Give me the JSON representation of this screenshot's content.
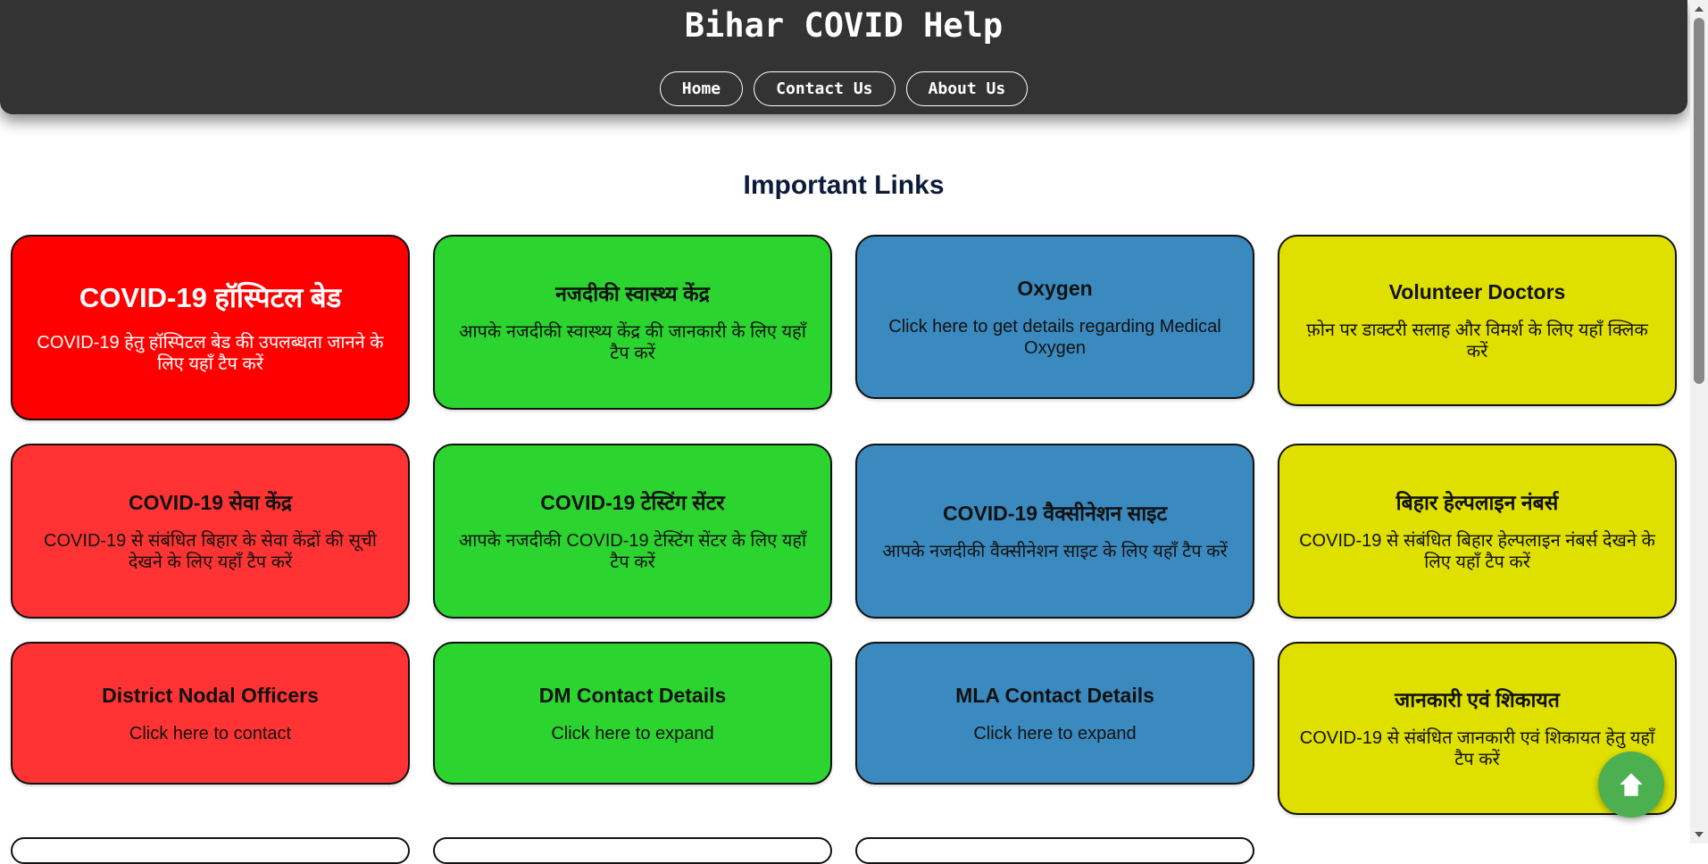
{
  "header": {
    "title": "Bihar COVID Help",
    "nav": [
      {
        "label": "Home"
      },
      {
        "label": "Contact Us"
      },
      {
        "label": "About Us"
      }
    ]
  },
  "main": {
    "section_title": "Important Links",
    "cards": [
      {
        "title": "COVID-19 हॉस्पिटल बेड",
        "description": "COVID-19 हेतु हॉस्पिटल बेड की उपलब्धता जानने के लिए यहाँ टैप करें",
        "color": "#ff0000"
      },
      {
        "title": "नजदीकी स्वास्थ्य केंद्र",
        "description": "आपके नजदीकी स्वास्थ्य केंद्र की जानकारी के लिए यहाँ टैप करें",
        "color": "#2bd42f"
      },
      {
        "title": "Oxygen",
        "description": "Click here to get details regarding Medical Oxygen",
        "color": "#3a8ac0"
      },
      {
        "title": "Volunteer Doctors",
        "description": "फ़ोन पर डाक्टरी सलाह और विमर्श के लिए यहाँ क्लिक करें",
        "color": "#e0e000"
      },
      {
        "title": "COVID-19 सेवा केंद्र",
        "description": "COVID-19 से संबंधित बिहार के सेवा केंद्रों की सूची देखने के लिए यहाँ टैप करें",
        "color": "#ff3333"
      },
      {
        "title": "COVID-19 टेस्टिंग सेंटर",
        "description": "आपके नजदीकी COVID-19 टेस्टिंग सेंटर के लिए यहाँ टैप करें",
        "color": "#2bd42f"
      },
      {
        "title": "COVID-19 वैक्सीनेशन साइट",
        "description": "आपके नजदीकी वैक्सीनेशन साइट के लिए यहाँ टैप करें",
        "color": "#3a8ac0"
      },
      {
        "title": "बिहार हेल्पलाइन नंबर्स",
        "description": "COVID-19 से संबंधित बिहार हेल्पलाइन नंबर्स देखने के लिए यहाँ टैप करें",
        "color": "#e0e000"
      },
      {
        "title": "District Nodal Officers",
        "description": "Click here to contact",
        "color": "#ff3333"
      },
      {
        "title": "DM Contact Details",
        "description": "Click here to expand",
        "color": "#2bd42f"
      },
      {
        "title": "MLA Contact Details",
        "description": "Click here to expand",
        "color": "#3a8ac0"
      },
      {
        "title": "जानकारी एवं शिकायत",
        "description": "COVID-19 से संबंधित जानकारी एवं शिकायत हेतु यहाँ टैप करें",
        "color": "#e0e000"
      }
    ]
  },
  "back_to_top": {
    "icon": "arrow-up-icon",
    "color": "#4caf50"
  }
}
